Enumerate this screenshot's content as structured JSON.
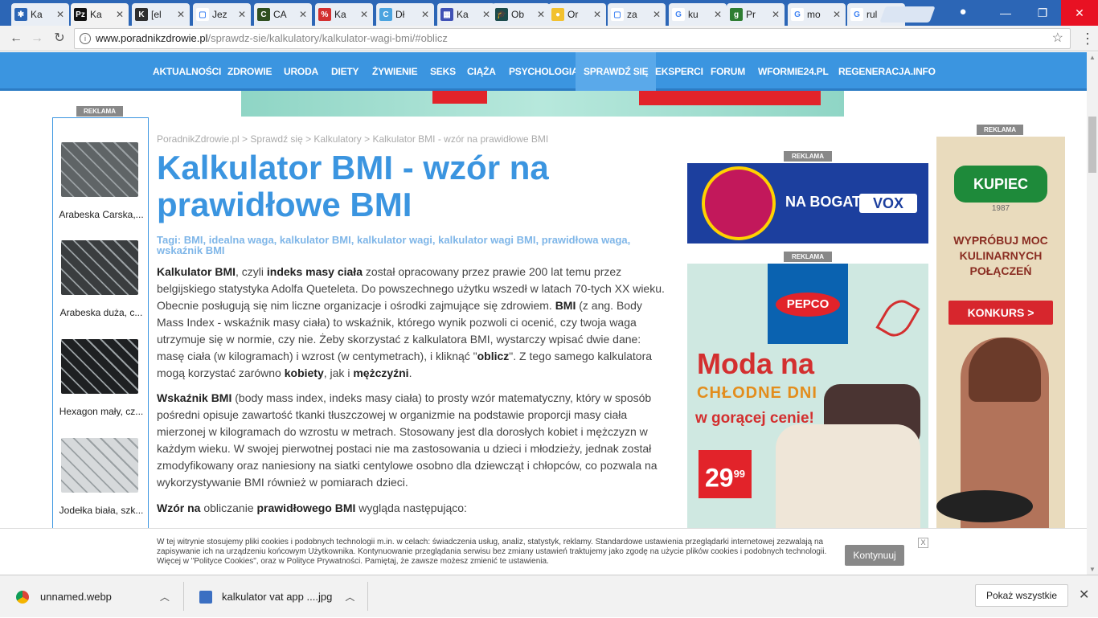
{
  "browser": {
    "tabs": [
      {
        "label": "Ka",
        "fav_color": "#2c66b6",
        "fav_glyph": "✱"
      },
      {
        "label": "Ka",
        "fav_color": "#111111",
        "fav_glyph": "Pz",
        "active": true
      },
      {
        "label": "[el",
        "fav_color": "#2e2e2e",
        "fav_glyph": "K"
      },
      {
        "label": "Jez",
        "fav_color": "#ffffff",
        "fav_glyph": "▢"
      },
      {
        "label": "CA",
        "fav_color": "#2f4f1f",
        "fav_glyph": "C"
      },
      {
        "label": "Ka",
        "fav_color": "#d32f2f",
        "fav_glyph": "%"
      },
      {
        "label": "Dł",
        "fav_color": "#4aa3df",
        "fav_glyph": "C"
      },
      {
        "label": "Ka",
        "fav_color": "#3f51b5",
        "fav_glyph": "▦"
      },
      {
        "label": "Ob",
        "fav_color": "#1b4b4b",
        "fav_glyph": "🎓"
      },
      {
        "label": "Or",
        "fav_color": "#f2c12e",
        "fav_glyph": "●"
      },
      {
        "label": "za",
        "fav_color": "#ffffff",
        "fav_glyph": "▢"
      },
      {
        "label": "ku",
        "fav_color": "#ffffff",
        "fav_glyph": "G"
      },
      {
        "label": "Pr",
        "fav_color": "#2e7d32",
        "fav_glyph": "g"
      },
      {
        "label": "mo",
        "fav_color": "#ffffff",
        "fav_glyph": "G"
      },
      {
        "label": "rul",
        "fav_color": "#ffffff",
        "fav_glyph": "G"
      }
    ],
    "url_host": "www.poradnikzdrowie.pl",
    "url_path": "/sprawdz-sie/kalkulatory/kalkulator-wagi-bmi/#oblicz"
  },
  "nav": {
    "items": [
      "AKTUALNOŚCI",
      "ZDROWIE",
      "URODA",
      "DIETY",
      "ŻYWIENIE",
      "SEKS",
      "CIĄŻA",
      "PSYCHOLOGIA",
      "SPRAWDŹ SIĘ",
      "EKSPERCI",
      "FORUM",
      "WFORMIE24.PL",
      "REGENERACJA.INFO"
    ],
    "active_index": 8
  },
  "ads": {
    "label": "REKLAMA",
    "left_tiles": [
      {
        "label": "Arabeska Carska,...",
        "color": "#5f6466"
      },
      {
        "label": "Arabeska duża, c...",
        "color": "#3a3d3f"
      },
      {
        "label": "Hexagon mały, cz...",
        "color": "#1e2022"
      },
      {
        "label": "Jodełka biała, szk...",
        "color": "#d6d9db"
      }
    ],
    "vox_text": "NA BOGATO Z",
    "vox_logo": "VOX",
    "pepco_logo": "PEPCO",
    "pepco_line1": "Moda na",
    "pepco_line2": "CHŁODNE DNI",
    "pepco_line3": "w gorącej cenie!",
    "pepco_price": "29",
    "pepco_price_cents": "99",
    "kupiec_logo": "KUPIEC",
    "kupiec_year": "1987",
    "kupiec_copy": "WYPRÓBUJ MOC KULINARNYCH POŁĄCZEŃ",
    "kupiec_cta": "KONKURS >"
  },
  "article": {
    "breadcrumbs": "PoradnikZdrowie.pl > Sprawdź się > Kalkulatory > Kalkulator BMI - wzór na prawidłowe BMI",
    "title": "Kalkulator BMI - wzór na prawidłowe BMI",
    "tags": "Tagi: BMI, idealna waga, kalkulator BMI, kalkulator wagi, kalkulator wagi BMI, prawidłowa waga, wskaźnik BMI",
    "p1_a": "Kalkulator BMI",
    "p1_b": ", czyli ",
    "p1_c": "indeks masy ciała",
    "p1_d": " został opracowany przez prawie 200 lat temu przez belgijskiego statystyka Adolfa Queteleta. Do powszechnego użytku wszedł w latach 70-tych XX wieku. Obecnie posługują się nim liczne organizacje i ośrodki zajmujące się zdrowiem. ",
    "p1_e": "BMI",
    "p1_f": " (z ang. Body Mass Index - wskaźnik masy ciała) to wskaźnik, którego wynik pozwoli ci ocenić, czy twoja waga utrzymuje się w normie, czy nie. Żeby skorzystać z kalkulatora BMI, wystarczy wpisać dwie dane: masę ciała (w kilogramach) i wzrost (w centymetrach), i kliknąć \"",
    "p1_g": "oblicz",
    "p1_h": "\". Z tego samego kalkulatora mogą korzystać zarówno ",
    "p1_i": "kobiety",
    "p1_j": ", jak i ",
    "p1_k": "mężczyźni",
    "p1_l": ".",
    "p2_a": "Wskaźnik BMI",
    "p2_b": " (body mass index, indeks masy ciała) to prosty wzór matematyczny, który w sposób pośredni opisuje zawartość tkanki tłuszczowej w organizmie na podstawie proporcji masy ciała mierzonej w kilogramach do wzrostu w metrach. Stosowany jest dla dorosłych kobiet i mężczyzn w każdym wieku. W swojej pierwotnej postaci nie ma zastosowania u dzieci i młodzieży, jednak został zmodyfikowany oraz naniesiony na siatki centylowe osobno dla dziewcząt i chłopców, co pozwala na wykorzystywanie BMI również w pomiarach dzieci.",
    "p3_a": "Wzór na",
    "p3_b": " obliczanie ",
    "p3_c": "prawidłowego BMI",
    "p3_d": " wygląda następująco:"
  },
  "cookie": {
    "message": "W tej witrynie stosujemy pliki cookies i podobnych technologii m.in. w celach: świadczenia usług, analiz, statystyk, reklamy. Standardowe ustawienia przeglądarki internetowej zezwalają na zapisywanie ich na urządzeniu końcowym Użytkownika. Kontynuowanie przeglądania serwisu bez zmiany ustawień traktujemy jako zgodę na użycie plików cookies i podobnych technologii. Więcej w \"Polityce Cookies\", oraz w Polityce Prywatności. Pamiętaj, że zawsze możesz zmienić te ustawienia.",
    "button": "Kontynuuj",
    "close": "X"
  },
  "downloads": {
    "items": [
      {
        "name": "unnamed.webp",
        "icon_color": "#db4437"
      },
      {
        "name": "kalkulator vat app ....jpg",
        "icon_color": "#3b6fc2"
      }
    ],
    "show_all": "Pokaż wszystkie"
  }
}
